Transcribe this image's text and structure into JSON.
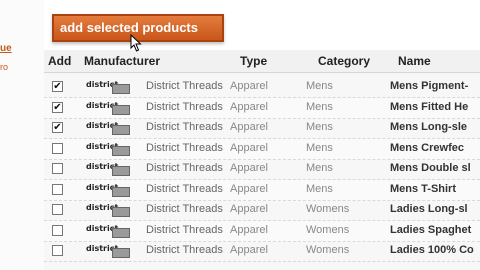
{
  "left_panel": {
    "link": "ue",
    "sub": "ro"
  },
  "toolbar": {
    "add_selected_label": "add selected products"
  },
  "table": {
    "headers": {
      "add": "Add",
      "manufacturer": "Manufacturer",
      "type": "Type",
      "category": "Category",
      "name": "Name"
    },
    "rows": [
      {
        "checked": true,
        "check_mark": "✔",
        "logo": "district",
        "manufacturer": "District Threads",
        "type": "Apparel",
        "category": "Mens",
        "name": "Mens Pigment-"
      },
      {
        "checked": true,
        "check_mark": "✔",
        "logo": "district",
        "manufacturer": "District Threads",
        "type": "Apparel",
        "category": "Mens",
        "name": "Mens Fitted He"
      },
      {
        "checked": true,
        "check_mark": "✔",
        "logo": "district",
        "manufacturer": "District Threads",
        "type": "Apparel",
        "category": "Mens",
        "name": "Mens Long-sle"
      },
      {
        "checked": false,
        "check_mark": "",
        "logo": "district",
        "manufacturer": "District Threads",
        "type": "Apparel",
        "category": "Mens",
        "name": "Mens Crewfec"
      },
      {
        "checked": false,
        "check_mark": "",
        "logo": "district",
        "manufacturer": "District Threads",
        "type": "Apparel",
        "category": "Mens",
        "name": "Mens Double sl"
      },
      {
        "checked": false,
        "check_mark": "",
        "logo": "district",
        "manufacturer": "District Threads",
        "type": "Apparel",
        "category": "Mens",
        "name": "Mens T-Shirt"
      },
      {
        "checked": false,
        "check_mark": "",
        "logo": "district",
        "manufacturer": "District Threads",
        "type": "Apparel",
        "category": "Womens",
        "name": "Ladies Long-sl"
      },
      {
        "checked": false,
        "check_mark": "",
        "logo": "district",
        "manufacturer": "District Threads",
        "type": "Apparel",
        "category": "Womens",
        "name": "Ladies Spaghet"
      },
      {
        "checked": false,
        "check_mark": "",
        "logo": "district",
        "manufacturer": "District Threads",
        "type": "Apparel",
        "category": "Womens",
        "name": "Ladies 100% Co"
      }
    ]
  },
  "icons": {
    "cursor": "mouse-pointer-icon",
    "checkbox": "checkbox-icon"
  },
  "colors": {
    "accent": "#d2632a",
    "accent_border": "#a9430f"
  }
}
